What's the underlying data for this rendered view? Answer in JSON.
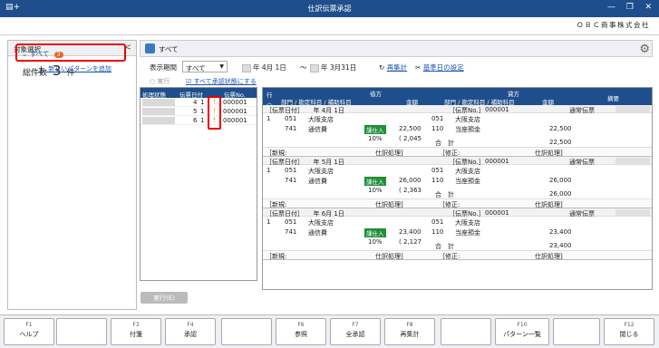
{
  "window": {
    "title": "仕訳伝票承認",
    "company": "ＯＢＣ商事株式会社"
  },
  "left": {
    "header": "対象選択",
    "total_label": "総件数",
    "total_count": "3",
    "total_unit": "件",
    "tree": [
      {
        "label": "すべて",
        "badge": "3"
      },
      {
        "label": "新しいパターンを追加"
      }
    ]
  },
  "crumb": {
    "label": "すべて"
  },
  "filter": {
    "period_label": "表示期間",
    "period_value": "すべて",
    "date_from": "年  4月  1日",
    "date_to": "年  3月31日",
    "recalc": "再集計",
    "base_date": "基準日の設定",
    "exec": "実行",
    "all_approve": "すべて承認状態にする"
  },
  "mid": {
    "headers": [
      "処理状態",
      "伝票日付",
      "伝票No."
    ],
    "rows": [
      {
        "m": "4",
        "d": "1",
        "no": "000001"
      },
      {
        "m": "5",
        "d": "1",
        "no": "000001"
      },
      {
        "m": "6",
        "d": "1",
        "no": "000001"
      }
    ],
    "exec_button": "実行(E)"
  },
  "journal": {
    "headers": {
      "row": "行",
      "debit": "借方",
      "credit": "貸方",
      "dept": "部門 / 勘定科目 / 補助科目",
      "amount": "金額",
      "memo": "摘要"
    },
    "entries": [
      {
        "date": "［伝票日付］　　年  4月  1日",
        "no_label": "［伝票No.］",
        "no": "000001",
        "kind": "通常伝票",
        "dcode1": "051",
        "dname1": "大阪支店",
        "dcode2": "741",
        "dname2": "通信費",
        "tax_tag": "課仕入",
        "rate": "10%",
        "damt": "22,500",
        "tax": "( 2,045",
        "ccode1": "051",
        "cname1": "大阪支店",
        "ccode2": "110",
        "cname2": "当座預金",
        "camt": "22,500",
        "total_label": "合　計",
        "total": "22,500",
        "new_label": "［新規:",
        "proc": "仕訳処理]",
        "mod_label": "［修正:",
        "proc2": "仕訳処理]",
        "line": "1"
      },
      {
        "date": "［伝票日付］　　年  5月  1日",
        "no_label": "［伝票No.］",
        "no": "000001",
        "kind": "通常伝票",
        "dcode1": "051",
        "dname1": "大阪支店",
        "dcode2": "741",
        "dname2": "通信費",
        "tax_tag": "課仕入",
        "rate": "10%",
        "damt": "26,000",
        "tax": "( 2,363",
        "ccode1": "051",
        "cname1": "大阪支店",
        "ccode2": "110",
        "cname2": "当座預金",
        "camt": "26,000",
        "total_label": "合　計",
        "total": "26,000",
        "new_label": "［新規:",
        "proc": "仕訳処理]",
        "mod_label": "［修正:",
        "proc2": "仕訳処理]",
        "line": "1"
      },
      {
        "date": "［伝票日付］　　年  6月  1日",
        "no_label": "［伝票No.］",
        "no": "000001",
        "kind": "通常伝票",
        "dcode1": "051",
        "dname1": "大阪支店",
        "dcode2": "741",
        "dname2": "通信費",
        "tax_tag": "課仕入",
        "rate": "10%",
        "damt": "23,400",
        "tax": "( 2,127",
        "ccode1": "051",
        "cname1": "大阪支店",
        "ccode2": "110",
        "cname2": "当座預金",
        "camt": "23,400",
        "total_label": "合　計",
        "total": "23,400",
        "new_label": "［新規:",
        "proc": "仕訳処理]",
        "mod_label": "［修正:",
        "proc2": "仕訳処理]",
        "line": "1"
      }
    ]
  },
  "fkeys": [
    {
      "k": "F1",
      "v": "ヘルプ"
    },
    {
      "k": "",
      "v": ""
    },
    {
      "k": "F3",
      "v": "付箋"
    },
    {
      "k": "F4",
      "v": "承認"
    },
    {
      "k": "",
      "v": ""
    },
    {
      "k": "F6",
      "v": "参照"
    },
    {
      "k": "F7",
      "v": "全承認"
    },
    {
      "k": "F8",
      "v": "再集計"
    },
    {
      "k": "",
      "v": ""
    },
    {
      "k": "F10",
      "v": "パターン一覧"
    },
    {
      "k": "",
      "v": ""
    },
    {
      "k": "F12",
      "v": "閉じる"
    }
  ]
}
